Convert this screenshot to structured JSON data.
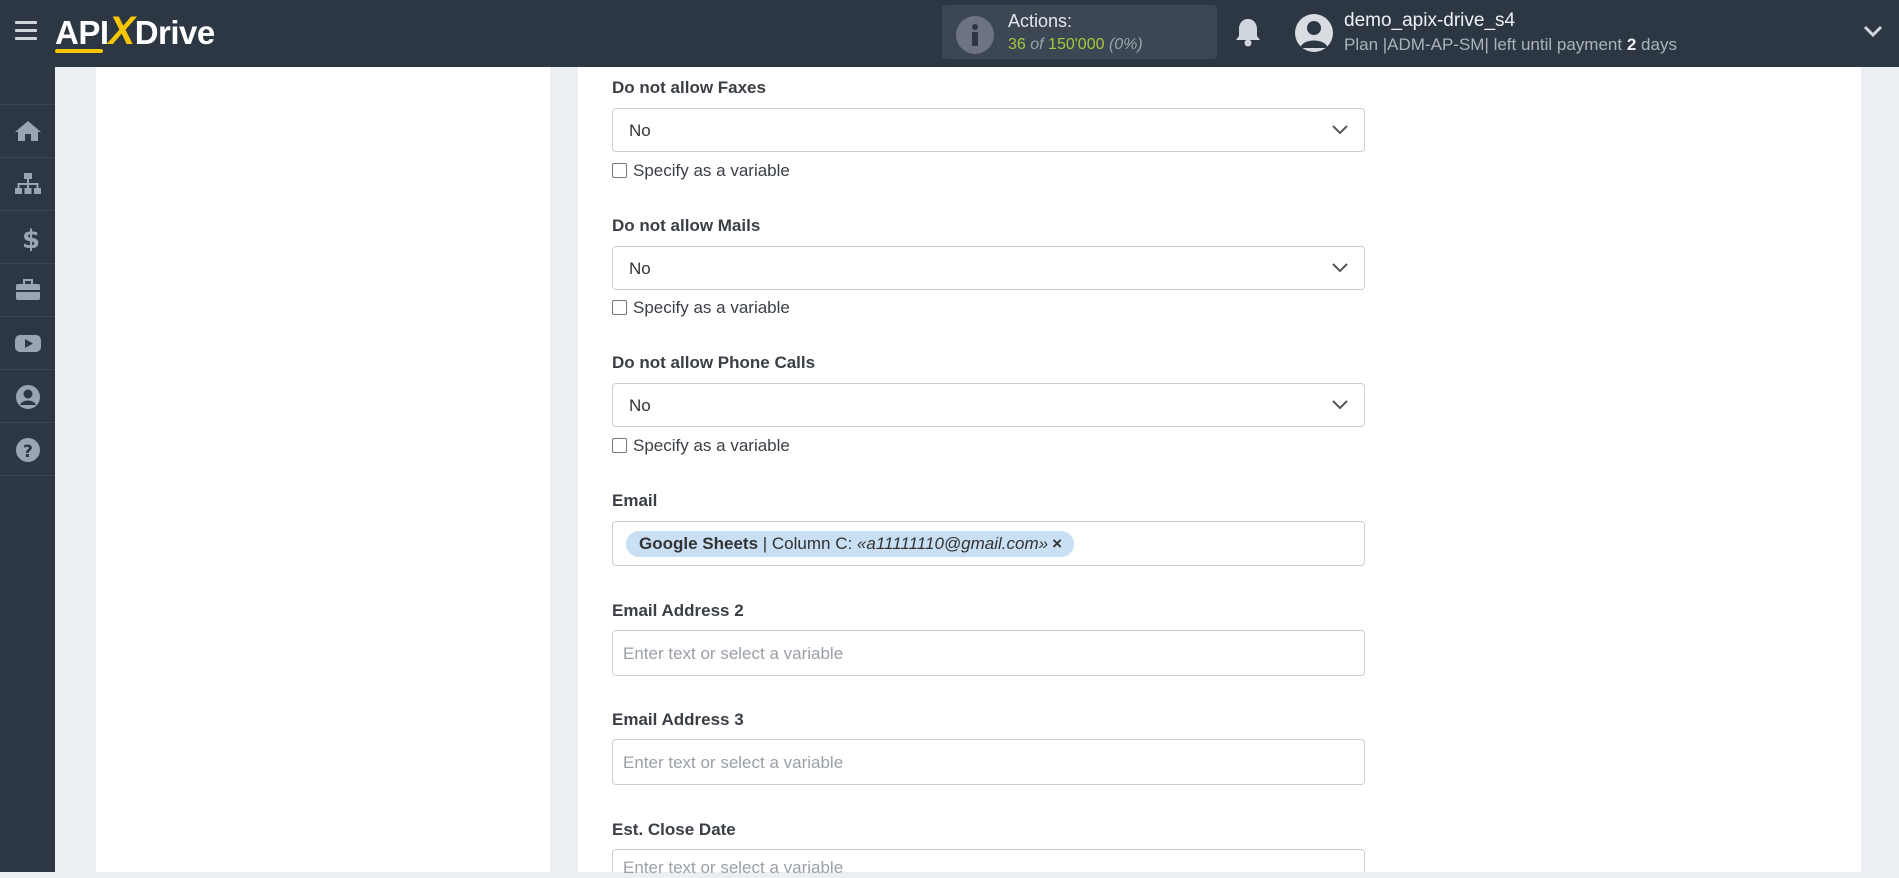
{
  "header": {
    "logo_left": "API",
    "logo_x": "X",
    "logo_right": "Drive",
    "actions_title": "Actions:",
    "actions_used": "36",
    "actions_of": "of",
    "actions_total": "150'000",
    "actions_percent": "(0%)",
    "username": "demo_apix-drive_s4",
    "plan_prefix": "Plan |ADM-AP-SM| left until payment",
    "plan_days": "2",
    "plan_suffix": "days"
  },
  "sidebar": {
    "items": [
      "home-icon",
      "sitemap-icon",
      "dollar-icon",
      "briefcase-icon",
      "youtube-icon",
      "user-circle-icon",
      "help-icon"
    ]
  },
  "form": {
    "fields": [
      {
        "label": "Do not allow Faxes",
        "value": "No",
        "checkbox": "Specify as a variable"
      },
      {
        "label": "Do not allow Mails",
        "value": "No",
        "checkbox": "Specify as a variable"
      },
      {
        "label": "Do not allow Phone Calls",
        "value": "No",
        "checkbox": "Specify as a variable"
      }
    ],
    "email": {
      "label": "Email",
      "tag_source": "Google Sheets",
      "tag_column": " | Column C: ",
      "tag_value": "«a11111110@gmail.com»",
      "tag_remove": "×"
    },
    "email2": {
      "label": "Email Address 2",
      "placeholder": "Enter text or select a variable"
    },
    "email3": {
      "label": "Email Address 3",
      "placeholder": "Enter text or select a variable"
    },
    "close_date": {
      "label": "Est. Close Date",
      "placeholder": "Enter text or select a variable"
    }
  },
  "colors": {
    "topbar": "#2d3743",
    "accent_yellow": "#f7c600",
    "actions_green": "#a6c63c",
    "tag_blue": "#c9dff3"
  }
}
